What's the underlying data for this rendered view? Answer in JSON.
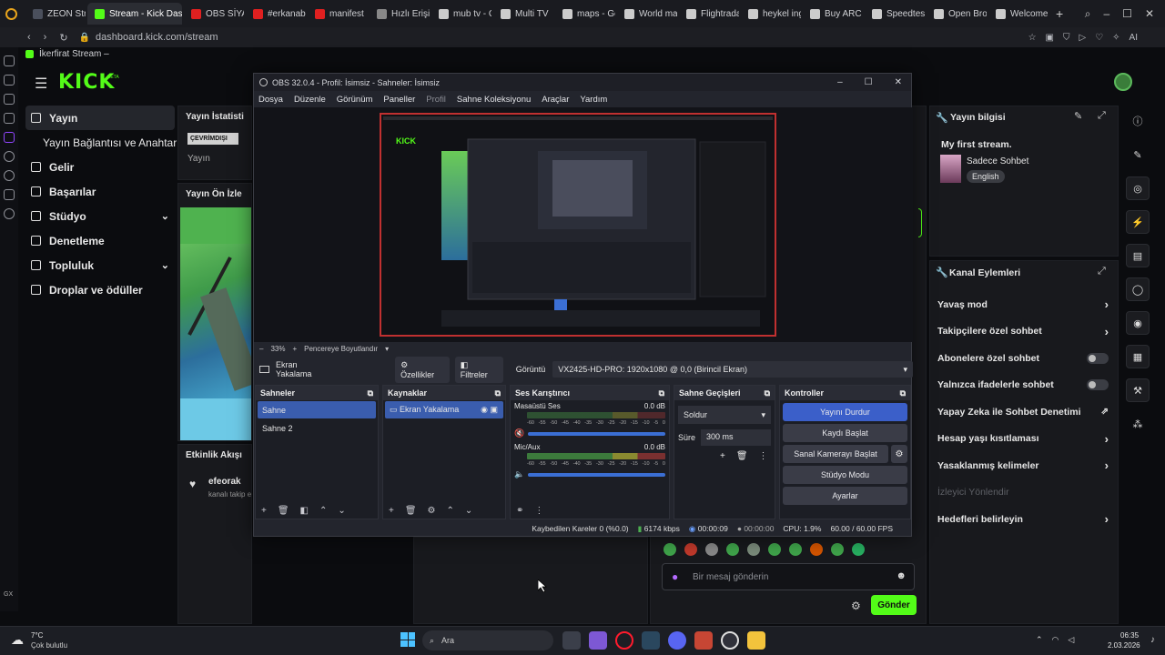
{
  "browser": {
    "tabs": [
      {
        "label": "ZEON Stre",
        "color": "#4a4f5c"
      },
      {
        "label": "Stream - Kick Dash",
        "color": "#53fc18",
        "active": true
      },
      {
        "label": "OBS SİYAH",
        "color": "#e02020"
      },
      {
        "label": "#erkanab",
        "color": "#e02020"
      },
      {
        "label": "manifest",
        "color": "#e02020"
      },
      {
        "label": "Hızlı Erişim",
        "color": "#888888"
      },
      {
        "label": "mub tv - C",
        "color": "#cccccc"
      },
      {
        "label": "Multi TV",
        "color": "#cccccc"
      },
      {
        "label": "maps - Go",
        "color": "#cccccc"
      },
      {
        "label": "World ma",
        "color": "#cccccc"
      },
      {
        "label": "Flightrada",
        "color": "#cccccc"
      },
      {
        "label": "heykel ing",
        "color": "#cccccc"
      },
      {
        "label": "Buy ARC F",
        "color": "#cccccc"
      },
      {
        "label": "Speedtest",
        "color": "#cccccc"
      },
      {
        "label": "Open Broa",
        "color": "#cccccc"
      },
      {
        "label": "Welcome",
        "color": "#cccccc"
      }
    ],
    "url": "dashboard.kick.com/stream",
    "bookmark": "İkerfirat Stream –",
    "ai_label": "AI"
  },
  "kick": {
    "logo": "KICK",
    "logo_badge": "BETA",
    "nav": [
      {
        "label": "Yayın",
        "icon": "broadcast-icon",
        "active": true
      },
      {
        "label": "Yayın Bağlantısı ve Anahtarı",
        "sub": true
      },
      {
        "label": "Gelir",
        "icon": "revenue-icon"
      },
      {
        "label": "Başarılar",
        "icon": "trophy-icon"
      },
      {
        "label": "Stüdyo",
        "icon": "studio-icon",
        "chevron": true
      },
      {
        "label": "Denetleme",
        "icon": "wrench-icon"
      },
      {
        "label": "Topluluk",
        "icon": "community-icon",
        "chevron": true
      },
      {
        "label": "Droplar ve ödüller",
        "icon": "gift-icon"
      }
    ],
    "stats_title": "Yayın İstatisti",
    "offline_badge": "ÇEVRİMDIŞI",
    "stats_sub": "Yayın",
    "preview_title": "Yayın Ön İzle",
    "activity_title": "Etkinlik Akışı",
    "activity_user": "efeorak",
    "activity_text": "kanalı takip e",
    "stream_info": {
      "title": "Yayın bilgisi",
      "stream_name": "My first stream.",
      "category": "Sadece Sohbet",
      "language": "English"
    },
    "channel_actions": {
      "title": "Kanal Eylemleri",
      "items": [
        {
          "label": "Yavaş mod",
          "type": "chevron"
        },
        {
          "label": "Takipçilere özel sohbet",
          "type": "chevron"
        },
        {
          "label": "Abonelere özel sohbet",
          "type": "toggle"
        },
        {
          "label": "Yalnızca ifadelerle sohbet",
          "type": "toggle"
        },
        {
          "label": "Yapay Zeka ile Sohbet Denetimi",
          "type": "external"
        },
        {
          "label": "Hesap yaşı kısıtlaması",
          "type": "chevron"
        },
        {
          "label": "Yasaklanmış kelimeler",
          "type": "chevron"
        },
        {
          "label": "İzleyici Yönlendir",
          "type": "disabled"
        },
        {
          "label": "Hedefleri belirleyin",
          "type": "chevron"
        }
      ]
    },
    "chat": {
      "placeholder": "Bir mesaj gönderin",
      "send": "Gönder"
    }
  },
  "obs": {
    "title": "OBS 32.0.4 - Profil: İsimsiz - Sahneler: İsimsiz",
    "menu": [
      "Dosya",
      "Düzenle",
      "Görünüm",
      "Paneller",
      "Profil",
      "Sahne Koleksiyonu",
      "Araçlar",
      "Yardım"
    ],
    "zoom": "33%",
    "fit_label": "Pencereye Boyutlandır",
    "source_name": "Ekran Yakalama",
    "properties": "Özellikler",
    "filters": "Filtreler",
    "display_label": "Görüntü",
    "display_value": "VX2425-HD-PRO: 1920x1080 @ 0,0 (Birincil Ekran)",
    "scenes": {
      "title": "Sahneler",
      "items": [
        "Sahne",
        "Sahne 2"
      ]
    },
    "sources": {
      "title": "Kaynaklar",
      "items": [
        "Ekran Yakalama"
      ]
    },
    "mixer": {
      "title": "Ses Karıştırıcı",
      "channels": [
        {
          "name": "Masaüstü Ses",
          "db": "0.0 dB"
        },
        {
          "name": "Mic/Aux",
          "db": "0.0 dB"
        }
      ],
      "scale": [
        "-60",
        "-55",
        "-50",
        "-45",
        "-40",
        "-35",
        "-30",
        "-25",
        "-20",
        "-15",
        "-10",
        "-5",
        "0"
      ]
    },
    "transitions": {
      "title": "Sahne Geçişleri",
      "type": "Soldur",
      "duration_label": "Süre",
      "duration": "300 ms"
    },
    "controls": {
      "title": "Kontroller",
      "buttons": [
        "Yayını Durdur",
        "Kaydı Başlat",
        "Sanal Kamerayı Başlat",
        "Stüdyo Modu",
        "Ayarlar"
      ]
    },
    "status": {
      "dropped": "Kaybedilen Kareler 0 (%0.0)",
      "bitrate": "6174 kbps",
      "stream_time": "00:00:09",
      "rec_time": "00:00:00",
      "cpu": "CPU: 1.9%",
      "fps": "60.00 / 60.00 FPS"
    }
  },
  "taskbar": {
    "weather_temp": "7°C",
    "weather_desc": "Çok bulutlu",
    "search": "Ara",
    "time": "06:35",
    "date": "2.03.2026"
  }
}
